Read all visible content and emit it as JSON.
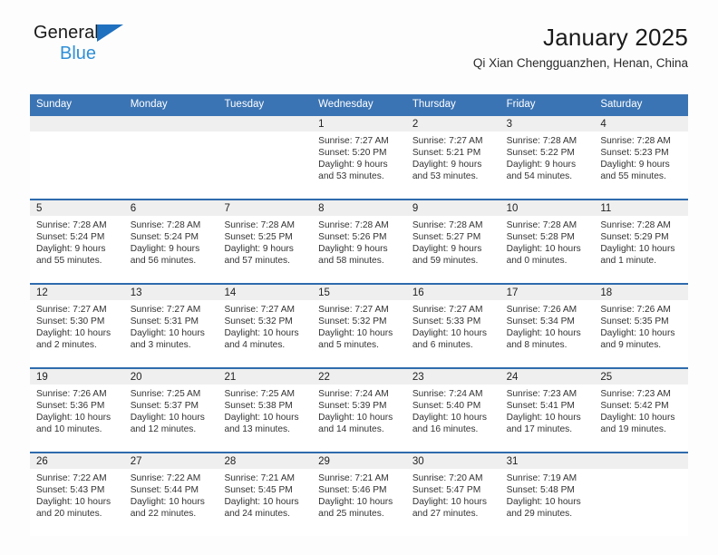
{
  "brand": {
    "name_top": "General",
    "name_bottom": "Blue",
    "triangle_color": "#1f70bf",
    "blue_text_color": "#2f8fd8"
  },
  "header": {
    "title": "January 2025",
    "subtitle": "Qi Xian Chengguanzhen, Henan, China",
    "accent_color": "#3b74b4",
    "row_divider_color": "#2f6bad",
    "daynum_band_color": "#efefef"
  },
  "weekdays": [
    "Sunday",
    "Monday",
    "Tuesday",
    "Wednesday",
    "Thursday",
    "Friday",
    "Saturday"
  ],
  "weeks": [
    [
      {
        "day": "",
        "lines": []
      },
      {
        "day": "",
        "lines": []
      },
      {
        "day": "",
        "lines": []
      },
      {
        "day": "1",
        "lines": [
          "Sunrise: 7:27 AM",
          "Sunset: 5:20 PM",
          "Daylight: 9 hours",
          "and 53 minutes."
        ]
      },
      {
        "day": "2",
        "lines": [
          "Sunrise: 7:27 AM",
          "Sunset: 5:21 PM",
          "Daylight: 9 hours",
          "and 53 minutes."
        ]
      },
      {
        "day": "3",
        "lines": [
          "Sunrise: 7:28 AM",
          "Sunset: 5:22 PM",
          "Daylight: 9 hours",
          "and 54 minutes."
        ]
      },
      {
        "day": "4",
        "lines": [
          "Sunrise: 7:28 AM",
          "Sunset: 5:23 PM",
          "Daylight: 9 hours",
          "and 55 minutes."
        ]
      }
    ],
    [
      {
        "day": "5",
        "lines": [
          "Sunrise: 7:28 AM",
          "Sunset: 5:24 PM",
          "Daylight: 9 hours",
          "and 55 minutes."
        ]
      },
      {
        "day": "6",
        "lines": [
          "Sunrise: 7:28 AM",
          "Sunset: 5:24 PM",
          "Daylight: 9 hours",
          "and 56 minutes."
        ]
      },
      {
        "day": "7",
        "lines": [
          "Sunrise: 7:28 AM",
          "Sunset: 5:25 PM",
          "Daylight: 9 hours",
          "and 57 minutes."
        ]
      },
      {
        "day": "8",
        "lines": [
          "Sunrise: 7:28 AM",
          "Sunset: 5:26 PM",
          "Daylight: 9 hours",
          "and 58 minutes."
        ]
      },
      {
        "day": "9",
        "lines": [
          "Sunrise: 7:28 AM",
          "Sunset: 5:27 PM",
          "Daylight: 9 hours",
          "and 59 minutes."
        ]
      },
      {
        "day": "10",
        "lines": [
          "Sunrise: 7:28 AM",
          "Sunset: 5:28 PM",
          "Daylight: 10 hours",
          "and 0 minutes."
        ]
      },
      {
        "day": "11",
        "lines": [
          "Sunrise: 7:28 AM",
          "Sunset: 5:29 PM",
          "Daylight: 10 hours",
          "and 1 minute."
        ]
      }
    ],
    [
      {
        "day": "12",
        "lines": [
          "Sunrise: 7:27 AM",
          "Sunset: 5:30 PM",
          "Daylight: 10 hours",
          "and 2 minutes."
        ]
      },
      {
        "day": "13",
        "lines": [
          "Sunrise: 7:27 AM",
          "Sunset: 5:31 PM",
          "Daylight: 10 hours",
          "and 3 minutes."
        ]
      },
      {
        "day": "14",
        "lines": [
          "Sunrise: 7:27 AM",
          "Sunset: 5:32 PM",
          "Daylight: 10 hours",
          "and 4 minutes."
        ]
      },
      {
        "day": "15",
        "lines": [
          "Sunrise: 7:27 AM",
          "Sunset: 5:32 PM",
          "Daylight: 10 hours",
          "and 5 minutes."
        ]
      },
      {
        "day": "16",
        "lines": [
          "Sunrise: 7:27 AM",
          "Sunset: 5:33 PM",
          "Daylight: 10 hours",
          "and 6 minutes."
        ]
      },
      {
        "day": "17",
        "lines": [
          "Sunrise: 7:26 AM",
          "Sunset: 5:34 PM",
          "Daylight: 10 hours",
          "and 8 minutes."
        ]
      },
      {
        "day": "18",
        "lines": [
          "Sunrise: 7:26 AM",
          "Sunset: 5:35 PM",
          "Daylight: 10 hours",
          "and 9 minutes."
        ]
      }
    ],
    [
      {
        "day": "19",
        "lines": [
          "Sunrise: 7:26 AM",
          "Sunset: 5:36 PM",
          "Daylight: 10 hours",
          "and 10 minutes."
        ]
      },
      {
        "day": "20",
        "lines": [
          "Sunrise: 7:25 AM",
          "Sunset: 5:37 PM",
          "Daylight: 10 hours",
          "and 12 minutes."
        ]
      },
      {
        "day": "21",
        "lines": [
          "Sunrise: 7:25 AM",
          "Sunset: 5:38 PM",
          "Daylight: 10 hours",
          "and 13 minutes."
        ]
      },
      {
        "day": "22",
        "lines": [
          "Sunrise: 7:24 AM",
          "Sunset: 5:39 PM",
          "Daylight: 10 hours",
          "and 14 minutes."
        ]
      },
      {
        "day": "23",
        "lines": [
          "Sunrise: 7:24 AM",
          "Sunset: 5:40 PM",
          "Daylight: 10 hours",
          "and 16 minutes."
        ]
      },
      {
        "day": "24",
        "lines": [
          "Sunrise: 7:23 AM",
          "Sunset: 5:41 PM",
          "Daylight: 10 hours",
          "and 17 minutes."
        ]
      },
      {
        "day": "25",
        "lines": [
          "Sunrise: 7:23 AM",
          "Sunset: 5:42 PM",
          "Daylight: 10 hours",
          "and 19 minutes."
        ]
      }
    ],
    [
      {
        "day": "26",
        "lines": [
          "Sunrise: 7:22 AM",
          "Sunset: 5:43 PM",
          "Daylight: 10 hours",
          "and 20 minutes."
        ]
      },
      {
        "day": "27",
        "lines": [
          "Sunrise: 7:22 AM",
          "Sunset: 5:44 PM",
          "Daylight: 10 hours",
          "and 22 minutes."
        ]
      },
      {
        "day": "28",
        "lines": [
          "Sunrise: 7:21 AM",
          "Sunset: 5:45 PM",
          "Daylight: 10 hours",
          "and 24 minutes."
        ]
      },
      {
        "day": "29",
        "lines": [
          "Sunrise: 7:21 AM",
          "Sunset: 5:46 PM",
          "Daylight: 10 hours",
          "and 25 minutes."
        ]
      },
      {
        "day": "30",
        "lines": [
          "Sunrise: 7:20 AM",
          "Sunset: 5:47 PM",
          "Daylight: 10 hours",
          "and 27 minutes."
        ]
      },
      {
        "day": "31",
        "lines": [
          "Sunrise: 7:19 AM",
          "Sunset: 5:48 PM",
          "Daylight: 10 hours",
          "and 29 minutes."
        ]
      },
      {
        "day": "",
        "lines": []
      }
    ]
  ]
}
